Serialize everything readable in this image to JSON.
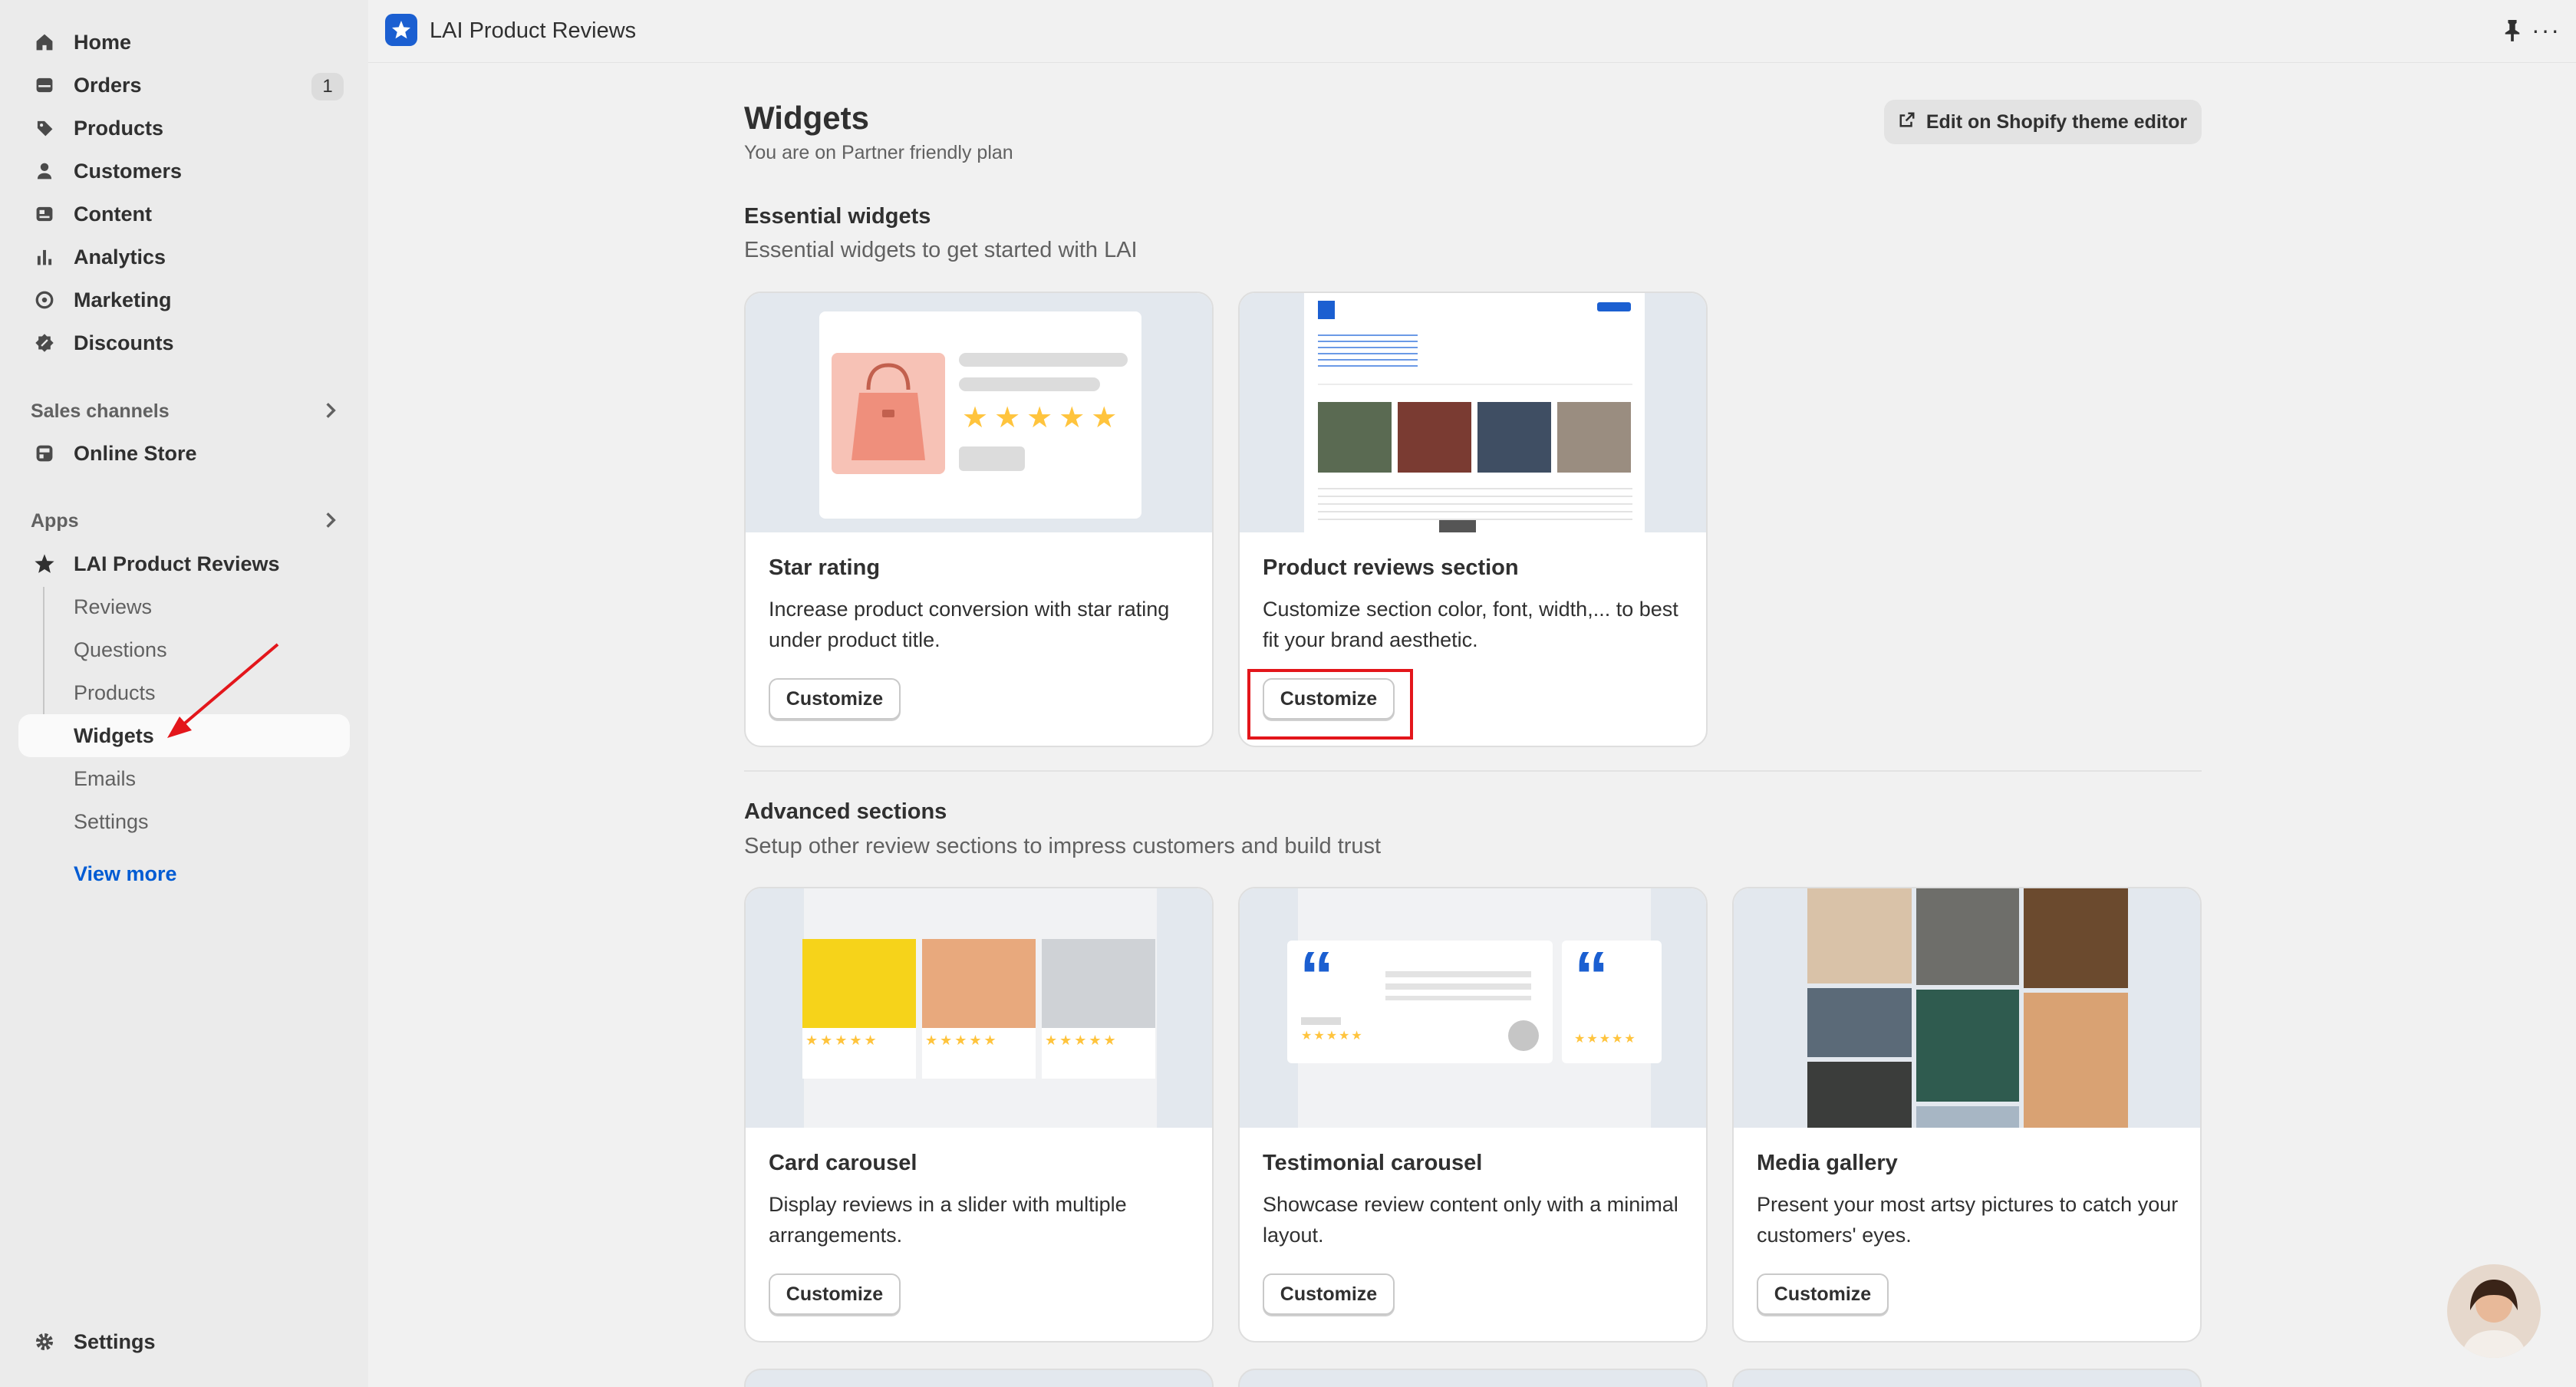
{
  "sidebar": {
    "items": [
      {
        "label": "Home",
        "icon": "home-icon"
      },
      {
        "label": "Orders",
        "icon": "orders-icon",
        "badge": "1"
      },
      {
        "label": "Products",
        "icon": "tag-icon"
      },
      {
        "label": "Customers",
        "icon": "person-icon"
      },
      {
        "label": "Content",
        "icon": "content-icon"
      },
      {
        "label": "Analytics",
        "icon": "bar-chart-icon"
      },
      {
        "label": "Marketing",
        "icon": "target-icon"
      },
      {
        "label": "Discounts",
        "icon": "discount-icon"
      }
    ],
    "sales_channels_label": "Sales channels",
    "online_store_label": "Online Store",
    "apps_label": "Apps",
    "app_label": "LAI Product Reviews",
    "sub_items": [
      "Reviews",
      "Questions",
      "Products",
      "Widgets",
      "Emails",
      "Settings"
    ],
    "active_sub_item": "Widgets",
    "view_more": "View more",
    "settings_label": "Settings"
  },
  "topbar": {
    "app_title": "LAI Product Reviews"
  },
  "page": {
    "title": "Widgets",
    "subtitle": "You are on Partner friendly plan",
    "edit_button": "Edit on Shopify theme editor"
  },
  "essential": {
    "title": "Essential widgets",
    "subtitle": "Essential widgets to get started with LAI",
    "cards": [
      {
        "title": "Star rating",
        "desc": "Increase product conversion with star rating under product title.",
        "button": "Customize"
      },
      {
        "title": "Product reviews section",
        "desc": "Customize section color, font, width,... to best fit your brand aesthetic.",
        "button": "Customize"
      }
    ]
  },
  "advanced": {
    "title": "Advanced sections",
    "subtitle": "Setup other review sections to impress customers and build trust",
    "cards": [
      {
        "title": "Card carousel",
        "desc": "Display reviews in a slider with multiple arrangements.",
        "button": "Customize"
      },
      {
        "title": "Testimonial carousel",
        "desc": "Showcase review content only with a minimal layout.",
        "button": "Customize"
      },
      {
        "title": "Media gallery",
        "desc": "Present your most artsy pictures to catch your customers' eyes.",
        "button": "Customize"
      }
    ]
  },
  "colors": {
    "accent": "#005bd3",
    "highlight": "#e3161b",
    "star": "#ffc43d",
    "app_icon": "#1b5fd1"
  }
}
